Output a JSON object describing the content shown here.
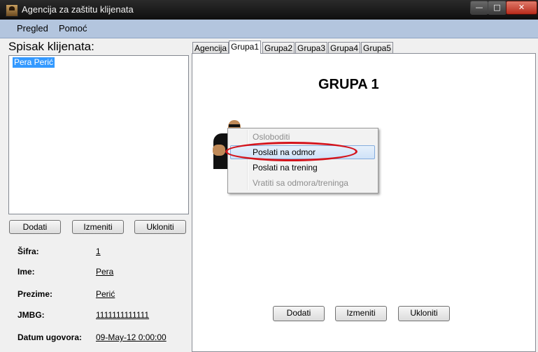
{
  "window": {
    "title": "Agencija za zaštitu klijenata",
    "min_glyph": "—",
    "max_glyph": "□",
    "close_glyph": "✕"
  },
  "menu": {
    "items": [
      "Pregled",
      "Pomoć"
    ]
  },
  "left": {
    "title": "Spisak klijenata:",
    "clients": [
      "Pera Perić"
    ],
    "buttons": {
      "add": "Dodati",
      "edit": "Izmeniti",
      "remove": "Ukloniti"
    },
    "fields": [
      {
        "label": "Šifra:",
        "value": "1"
      },
      {
        "label": "Ime:",
        "value": "Pera"
      },
      {
        "label": "Prezime:",
        "value": "Perić"
      },
      {
        "label": "JMBG:",
        "value": "1111111111111"
      },
      {
        "label": "Datum ugovora:",
        "value": "09-May-12 0:00:00"
      }
    ]
  },
  "tabs": {
    "items": [
      "Agencija",
      "Grupa1",
      "Grupa2",
      "Grupa3",
      "Grupa4",
      "Grupa5"
    ],
    "active": "Grupa1"
  },
  "panel": {
    "title": "GRUPA 1",
    "buttons": {
      "add": "Dodati",
      "edit": "Izmeniti",
      "remove": "Ukloniti"
    }
  },
  "context_menu": {
    "items": [
      {
        "label": "Osloboditi",
        "enabled": false
      },
      {
        "label": "Poslati na odmor",
        "enabled": true,
        "highlighted": true
      },
      {
        "label": "Poslati na trening",
        "enabled": true
      },
      {
        "label": "Vratiti sa odmora/treninga",
        "enabled": false
      }
    ]
  },
  "colors": {
    "selection": "#3399ff",
    "menubar": "#b3c5de",
    "highlight_ring": "#d4141c"
  }
}
